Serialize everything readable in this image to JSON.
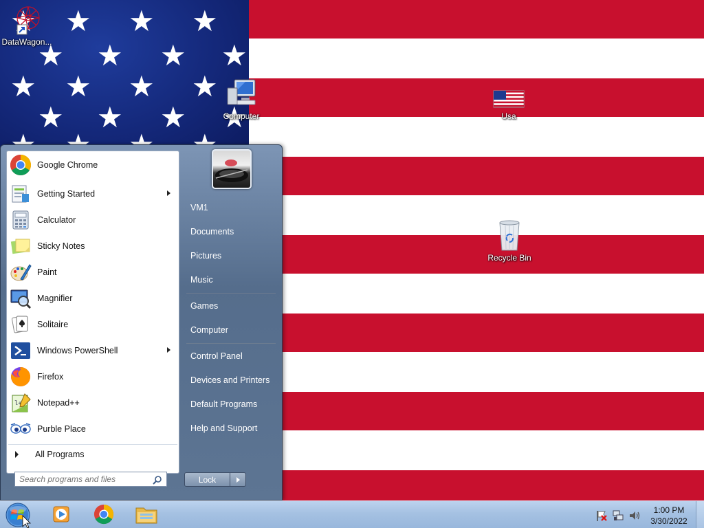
{
  "desktop": {
    "icons": [
      {
        "label": "DataWagon..."
      },
      {
        "label": "Computer"
      },
      {
        "label": "Usa"
      },
      {
        "label": "Recycle Bin"
      }
    ]
  },
  "start_menu": {
    "programs": [
      {
        "label": "Google Chrome",
        "icon": "chrome-icon",
        "has_submenu": false
      },
      {
        "label": "Getting Started",
        "icon": "getting-started-icon",
        "has_submenu": true
      },
      {
        "label": "Calculator",
        "icon": "calculator-icon",
        "has_submenu": false
      },
      {
        "label": "Sticky Notes",
        "icon": "sticky-notes-icon",
        "has_submenu": false
      },
      {
        "label": "Paint",
        "icon": "paint-icon",
        "has_submenu": false
      },
      {
        "label": "Magnifier",
        "icon": "magnifier-icon",
        "has_submenu": false
      },
      {
        "label": "Solitaire",
        "icon": "solitaire-icon",
        "has_submenu": false
      },
      {
        "label": "Windows PowerShell",
        "icon": "powershell-icon",
        "has_submenu": true
      },
      {
        "label": "Firefox",
        "icon": "firefox-icon",
        "has_submenu": false
      },
      {
        "label": "Notepad++",
        "icon": "notepadpp-icon",
        "has_submenu": false
      },
      {
        "label": "Purble Place",
        "icon": "purble-place-icon",
        "has_submenu": false
      }
    ],
    "all_programs": "All Programs",
    "search": {
      "placeholder": "Search programs and files",
      "value": ""
    },
    "right_items": [
      {
        "label": "VM1"
      },
      {
        "label": "Documents"
      },
      {
        "label": "Pictures"
      },
      {
        "label": "Music"
      },
      {
        "label": "Games"
      },
      {
        "label": "Computer"
      },
      {
        "label": "Control Panel"
      },
      {
        "label": "Devices and Printers"
      },
      {
        "label": "Default Programs"
      },
      {
        "label": "Help and Support"
      }
    ],
    "lock_label": "Lock"
  },
  "taskbar": {
    "pinned": [
      {
        "name": "Windows Media Player",
        "icon": "media-player-icon"
      },
      {
        "name": "Google Chrome",
        "icon": "chrome-icon"
      },
      {
        "name": "Windows Explorer",
        "icon": "file-explorer-icon"
      }
    ],
    "clock": {
      "time": "1:00 PM",
      "date": "3/30/2022"
    }
  }
}
